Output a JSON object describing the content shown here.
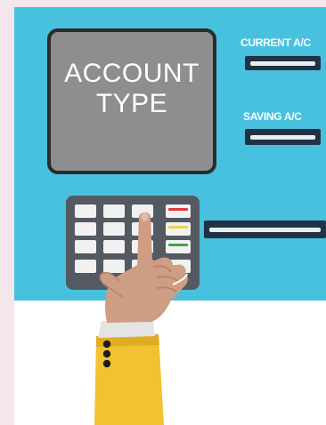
{
  "screen": {
    "line1": "ACCOUNT",
    "line2": "TYPE"
  },
  "options": {
    "current_label": "CURRENT A/C",
    "saving_label": "SAVING A/C"
  },
  "colors": {
    "panel": "#48c1df",
    "screen": "#8e8e8e",
    "keypad": "#535a61",
    "cancel_key": "#e03a3a",
    "clear_key": "#e6d64a",
    "enter_key": "#3da34a",
    "sleeve": "#f2c230"
  },
  "icons": {
    "hand": "pointing-hand-icon",
    "keypad": "keypad-icon",
    "card_slot": "card-slot-icon"
  }
}
